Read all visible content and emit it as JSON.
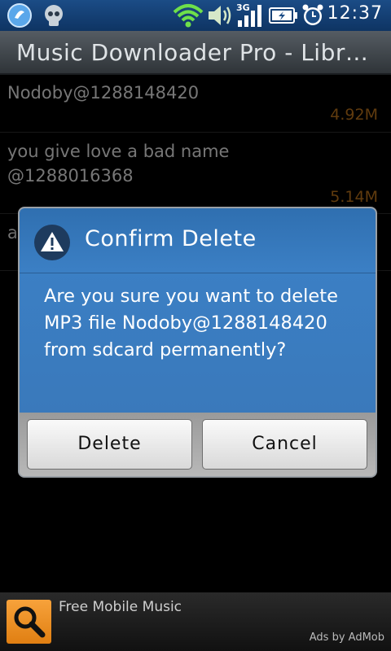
{
  "status_bar": {
    "time": "12:37",
    "icons": [
      "bluetooth-app-icon",
      "skull-app-icon",
      "wifi-icon",
      "volume-icon",
      "3g-signal-icon",
      "battery-icon",
      "alarm-clock-icon"
    ],
    "network_label": "3G"
  },
  "title_bar": {
    "title": "Music Downloader Pro - Libr…"
  },
  "list": {
    "items": [
      {
        "name": "Nodoby@1288148420",
        "size": "4.92M"
      },
      {
        "name": "you give love a bad name @1288016368",
        "size": "5.14M"
      },
      {
        "name": "a",
        "size": ""
      }
    ]
  },
  "dialog": {
    "title": "Confirm Delete",
    "icon": "warning-icon",
    "message": "Are you sure you want to delete MP3 file Nodoby@1288148420 from sdcard permanently?",
    "delete_label": "Delete",
    "cancel_label": "Cancel"
  },
  "ad": {
    "icon": "search-magnifier-icon",
    "text": "Free Mobile Music",
    "credit": "Ads by AdMob"
  },
  "colors": {
    "status_bar": "#1b4c86",
    "dialog_header": "#3b7fc4",
    "size_text": "#b06c1a",
    "ad_icon": "#f7a23b"
  }
}
